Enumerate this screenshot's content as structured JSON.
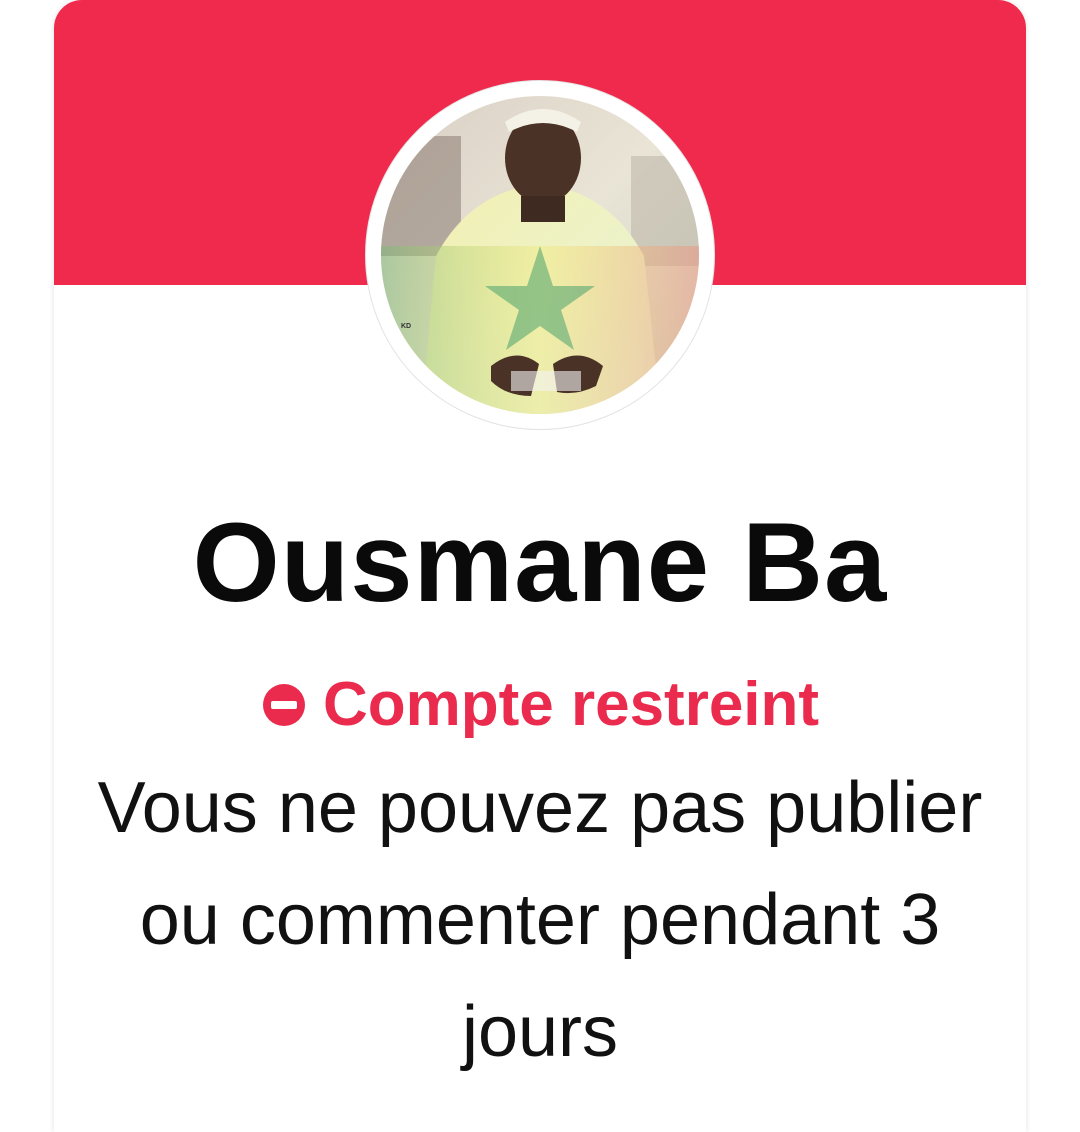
{
  "profile": {
    "name": "Ousmane Ba",
    "photo_watermark": "KD"
  },
  "restriction": {
    "icon": "no-entry-icon",
    "label": "Compte restreint",
    "message": "Vous ne pouvez pas publier ou commenter pendant 3 jours"
  },
  "colors": {
    "banner": "#ef2a4c",
    "status": "#ea2b4d",
    "text": "#0a0a0a",
    "background": "#ffffff"
  }
}
